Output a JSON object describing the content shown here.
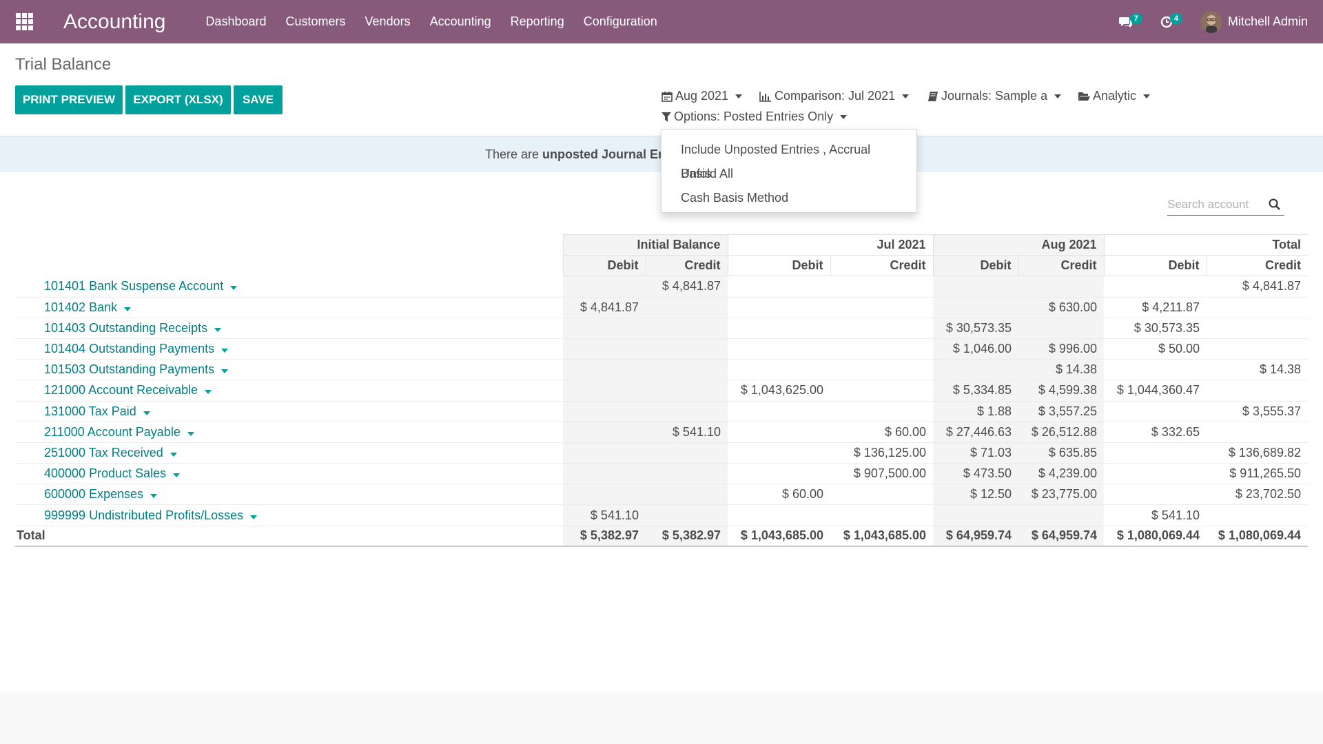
{
  "navbar": {
    "brand": "Accounting",
    "menu": [
      "Dashboard",
      "Customers",
      "Vendors",
      "Accounting",
      "Reporting",
      "Configuration"
    ],
    "messages_count": "7",
    "activities_count": "4",
    "user_name": "Mitchell Admin",
    "colors": {
      "bar": "#875a7b",
      "badge": "#00a09d"
    }
  },
  "page": {
    "title": "Trial Balance",
    "buttons": {
      "print": "Print Preview",
      "export": "Export (XLSX)",
      "save": "Save"
    }
  },
  "filters": {
    "date": "Aug 2021",
    "comparison": "Comparison: Jul 2021",
    "journals": "Journals: Sample a",
    "analytic": "Analytic",
    "options": "Options: Posted Entries Only"
  },
  "alert": {
    "prefix": "There are ",
    "strong": "unposted Journal Entr"
  },
  "options_dropdown": {
    "items": [
      "Include Unposted Entries , Accrual Basis",
      "Unfold All",
      "Cash Basis Method"
    ]
  },
  "search": {
    "placeholder": "Search account"
  },
  "table": {
    "groups": [
      "Initial Balance",
      "Jul 2021",
      "Aug 2021",
      "Total"
    ],
    "sub_headers": [
      "Debit",
      "Credit",
      "Debit",
      "Credit",
      "Debit",
      "Credit",
      "Debit",
      "Credit"
    ],
    "rows": [
      {
        "account": "101401 Bank Suspense Account",
        "cells": [
          "",
          "$ 4,841.87",
          "",
          "",
          "",
          "",
          "",
          "$ 4,841.87"
        ]
      },
      {
        "account": "101402 Bank",
        "cells": [
          "$ 4,841.87",
          "",
          "",
          "",
          "",
          "$ 630.00",
          "$ 4,211.87",
          ""
        ]
      },
      {
        "account": "101403 Outstanding Receipts",
        "cells": [
          "",
          "",
          "",
          "",
          "$ 30,573.35",
          "",
          "$ 30,573.35",
          ""
        ]
      },
      {
        "account": "101404 Outstanding Payments",
        "cells": [
          "",
          "",
          "",
          "",
          "$ 1,046.00",
          "$ 996.00",
          "$ 50.00",
          ""
        ]
      },
      {
        "account": "101503 Outstanding Payments",
        "cells": [
          "",
          "",
          "",
          "",
          "",
          "$ 14.38",
          "",
          "$ 14.38"
        ]
      },
      {
        "account": "121000 Account Receivable",
        "cells": [
          "",
          "",
          "$ 1,043,625.00",
          "",
          "$ 5,334.85",
          "$ 4,599.38",
          "$ 1,044,360.47",
          ""
        ]
      },
      {
        "account": "131000 Tax Paid",
        "cells": [
          "",
          "",
          "",
          "",
          "$ 1.88",
          "$ 3,557.25",
          "",
          "$ 3,555.37"
        ]
      },
      {
        "account": "211000 Account Payable",
        "cells": [
          "",
          "$ 541.10",
          "",
          "$ 60.00",
          "$ 27,446.63",
          "$ 26,512.88",
          "$ 332.65",
          ""
        ]
      },
      {
        "account": "251000 Tax Received",
        "cells": [
          "",
          "",
          "",
          "$ 136,125.00",
          "$ 71.03",
          "$ 635.85",
          "",
          "$ 136,689.82"
        ]
      },
      {
        "account": "400000 Product Sales",
        "cells": [
          "",
          "",
          "",
          "$ 907,500.00",
          "$ 473.50",
          "$ 4,239.00",
          "",
          "$ 911,265.50"
        ]
      },
      {
        "account": "600000 Expenses",
        "cells": [
          "",
          "",
          "$ 60.00",
          "",
          "$ 12.50",
          "$ 23,775.00",
          "",
          "$ 23,702.50"
        ]
      },
      {
        "account": "999999 Undistributed Profits/Losses",
        "cells": [
          "$ 541.10",
          "",
          "",
          "",
          "",
          "",
          "$ 541.10",
          ""
        ]
      }
    ],
    "total": {
      "label": "Total",
      "cells": [
        "$ 5,382.97",
        "$ 5,382.97",
        "$ 1,043,685.00",
        "$ 1,043,685.00",
        "$ 64,959.74",
        "$ 64,959.74",
        "$ 1,080,069.44",
        "$ 1,080,069.44"
      ]
    }
  }
}
